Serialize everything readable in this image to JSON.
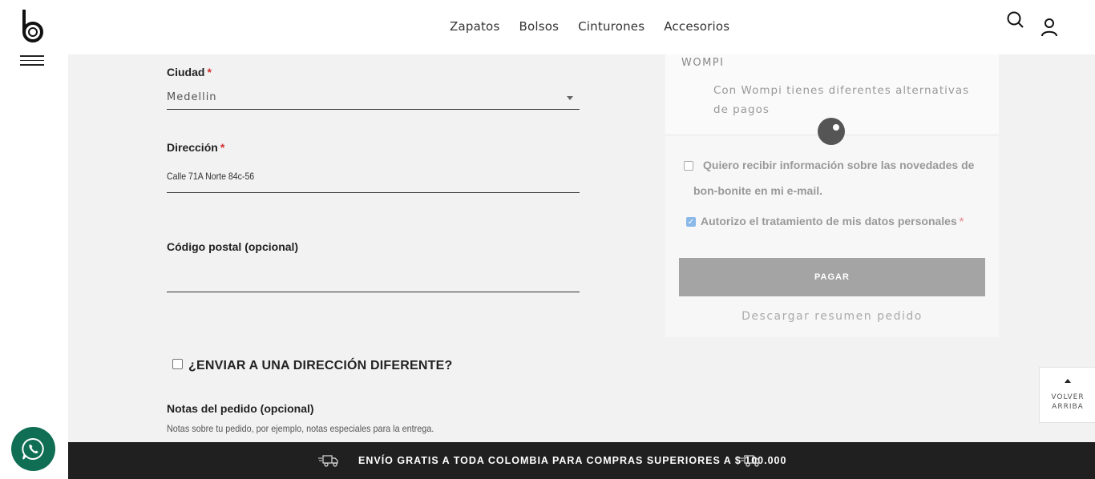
{
  "brand": {
    "logo_alt": "b"
  },
  "nav": {
    "items": [
      "Zapatos",
      "Bolsos",
      "Cinturones",
      "Accesorios"
    ]
  },
  "form": {
    "city": {
      "label": "Ciudad",
      "required_mark": "*",
      "value": "Medellin"
    },
    "address": {
      "label": "Dirección",
      "required_mark": "*",
      "value": "Calle 71A Norte 84c-56"
    },
    "postal": {
      "label": "Código postal (opcional)",
      "value": ""
    },
    "ship_different": {
      "label": "¿ENVIAR A UNA DIRECCIÓN DIFERENTE?",
      "checked": false
    },
    "notes": {
      "label": "Notas del pedido (opcional)",
      "placeholder": "Notas sobre tu pedido, por ejemplo, notas especiales para la entrega."
    }
  },
  "payment": {
    "method_title": "WOMPI",
    "method_desc": "Con Wompi tienes diferentes alternativas de pagos",
    "newsletter": {
      "label_line1": "Quiero recibir información sobre las novedades de",
      "label_line2": "bon-bonite en mi e-mail.",
      "checked": false
    },
    "privacy": {
      "label": "Autorizo el tratamiento de mis datos personales",
      "required_mark": "*",
      "checked": true
    },
    "pay_button": "PAGAR",
    "download_link": "Descargar resumen pedido"
  },
  "back_to_top": {
    "line1": "VOLVER",
    "line2": "ARRIBA"
  },
  "footer": {
    "message": "ENVÍO GRATIS A TODA COLOMBIA PARA COMPRAS SUPERIORES A $ 100.000"
  },
  "colors": {
    "accent_disabled": "#a4a4a4",
    "footer_bg": "#202020",
    "whatsapp": "#0f6e53",
    "required": "#d0302f"
  }
}
